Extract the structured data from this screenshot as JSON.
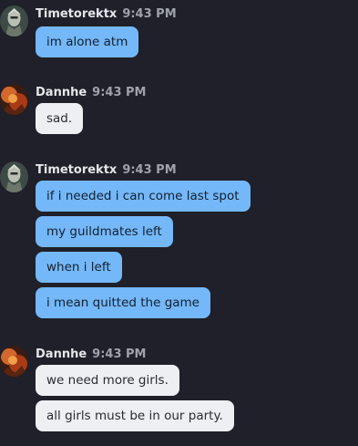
{
  "colors": {
    "background": "#1f2029",
    "bubble_blue": "#74b8f9",
    "bubble_light": "#eeeff2",
    "username": "#e6e6ea",
    "timestamp": "#a0a2ab"
  },
  "messages": [
    {
      "user": "Timetorektx",
      "avatar": "armored-knight-avatar",
      "time": "9:43 PM",
      "bubbles": [
        "im alone atm"
      ]
    },
    {
      "user": "Dannhe",
      "avatar": "fiery-warrior-avatar",
      "time": "9:43 PM",
      "bubbles": [
        "sad."
      ]
    },
    {
      "user": "Timetorektx",
      "avatar": "armored-knight-avatar",
      "time": "9:43 PM",
      "bubbles": [
        "if i needed i can come last spot",
        "my guildmates left",
        "when i left",
        "i mean quitted the game"
      ]
    },
    {
      "user": "Dannhe",
      "avatar": "fiery-warrior-avatar",
      "time": "9:43 PM",
      "bubbles": [
        "we need more girls.",
        "all girls must be in our party."
      ]
    }
  ]
}
